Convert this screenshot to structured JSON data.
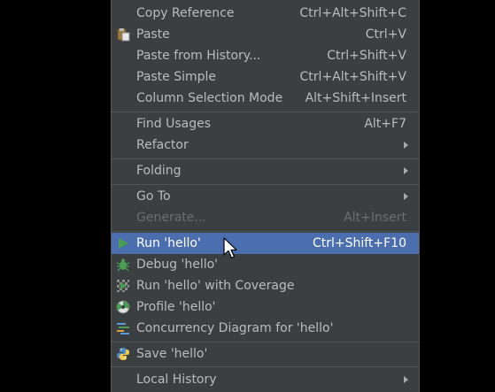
{
  "context_menu": {
    "items": [
      {
        "label": "Copy Reference",
        "shortcut": "Ctrl+Alt+Shift+C"
      },
      {
        "label": "Paste",
        "shortcut": "Ctrl+V",
        "icon": "paste-icon"
      },
      {
        "label": "Paste from History...",
        "shortcut": "Ctrl+Shift+V"
      },
      {
        "label": "Paste Simple",
        "shortcut": "Ctrl+Alt+Shift+V"
      },
      {
        "label": "Column Selection Mode",
        "shortcut": "Alt+Shift+Insert"
      },
      {
        "label": "Find Usages",
        "shortcut": "Alt+F7"
      },
      {
        "label": "Refactor",
        "submenu": true
      },
      {
        "label": "Folding",
        "submenu": true
      },
      {
        "label": "Go To",
        "submenu": true
      },
      {
        "label": "Generate...",
        "shortcut": "Alt+Insert",
        "disabled": true
      },
      {
        "label": "Run 'hello'",
        "shortcut": "Ctrl+Shift+F10",
        "icon": "run-icon",
        "selected": true
      },
      {
        "label": "Debug 'hello'",
        "icon": "debug-icon"
      },
      {
        "label": "Run 'hello' with Coverage",
        "icon": "coverage-icon"
      },
      {
        "label": "Profile 'hello'",
        "icon": "profile-icon"
      },
      {
        "label": "Concurrency Diagram for 'hello'",
        "icon": "concurrency-diagram-icon"
      },
      {
        "label": "Save 'hello'",
        "icon": "python-icon"
      },
      {
        "label": "Local History",
        "submenu": true
      }
    ]
  },
  "colors": {
    "menu_background": "#3c3f41",
    "selected_background": "#4b6eaf",
    "text": "#bbbbbb",
    "disabled_text": "#6b6e70",
    "run_green": "#499c54"
  }
}
